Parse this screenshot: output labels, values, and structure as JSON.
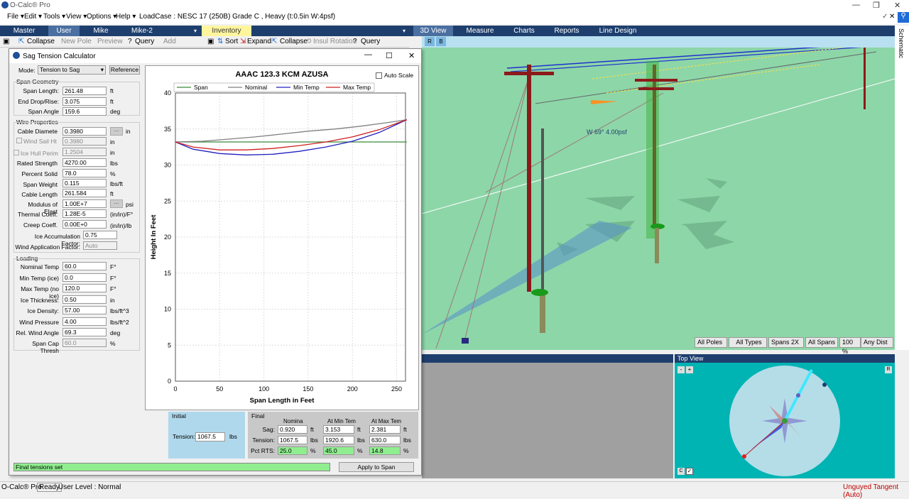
{
  "window": {
    "title": "O-Calc® Pro"
  },
  "menu": {
    "items": [
      "File ▾",
      "Edit ▾",
      "Tools ▾",
      "View ▾",
      "Options ▾",
      "Help ▾"
    ],
    "loadcase": "LoadCase : NESC  17 (250B) Grade C , Heavy (t:0.5in W:4psf)"
  },
  "tabs_left": [
    "Master",
    "User",
    "Mike",
    "Mike-2"
  ],
  "tab_inventory": "Inventory",
  "tabs_right": [
    "3D View",
    "Measure",
    "Charts",
    "Reports",
    "Line Design"
  ],
  "schematic_label": "Schematic",
  "toolbar_left": {
    "collapse": "Collapse",
    "new_pole": "New Pole",
    "preview": "Preview",
    "query": "Query",
    "add": "Add"
  },
  "toolbar_mid": {
    "sort": "Sort",
    "expand": "Expand",
    "collapse": "Collapse",
    "insul_rotation": "Insul Rotation",
    "query": "Query"
  },
  "view3d": {
    "btn_r": "R",
    "btn_b": "B",
    "wind_label": "W 69° 4.00psf",
    "controls": [
      "All Poles",
      "All Types",
      "Spans 2X",
      "All Spans",
      "100 %",
      "Any Dist"
    ]
  },
  "topview": {
    "title": "Top View",
    "btn_minus": "-",
    "btn_plus": "+",
    "btn_r": "R",
    "btn_c": "C"
  },
  "status": {
    "app": "O-Calc® Pro",
    "ready": "Ready",
    "user_level": "User Level : Normal",
    "right": "Unguyed Tangent (Auto)"
  },
  "dialog": {
    "title": "Sag Tension Calculator",
    "mode_label": "Mode:",
    "mode_value": "Tension to Sag",
    "reference_btn": "Reference",
    "span_geometry": {
      "title": "Span Geometry",
      "fields": [
        {
          "label": "Span Length:",
          "value": "261.48",
          "unit": "ft"
        },
        {
          "label": "End Drop/Rise:",
          "value": "3.075",
          "unit": "ft"
        },
        {
          "label": "Span Angle",
          "value": "159.6",
          "unit": "deg"
        }
      ]
    },
    "wire_properties": {
      "title": "Wire Properties",
      "cable_diameter": {
        "label": "Cable Diamete",
        "value": "0.3980",
        "unit": "in"
      },
      "wind_sail": {
        "label": "Wind Sail Ht",
        "value": "0.3980",
        "unit": "in"
      },
      "ice_hull": {
        "label": "Ice Hull Perim",
        "value": "1.2504",
        "unit": "in"
      },
      "fields": [
        {
          "label": "Rated Strength",
          "value": "4270.00",
          "unit": "lbs"
        },
        {
          "label": "Percent Solid",
          "value": "78.0",
          "unit": "%"
        },
        {
          "label": "Span Weight",
          "value": "0.115",
          "unit": "lbs/ft"
        },
        {
          "label": "Cable Length",
          "value": "261.584",
          "unit": "ft"
        },
        {
          "label": "Modulus of Elast",
          "value": "1.00E+7",
          "unit": "psi"
        },
        {
          "label": "Thermal Coeff.",
          "value": "1.28E-5",
          "unit": "(in/in)/F°"
        },
        {
          "label": "Creep Coeff.",
          "value": "0.00E+0",
          "unit": "(in/in)/lb"
        }
      ],
      "ice_accum": {
        "label": "Ice Accumulation Factor:",
        "value": "0.75"
      },
      "wind_app": {
        "label": "Wind Application Factor:",
        "value": "Auto"
      }
    },
    "loading": {
      "title": "Loading",
      "fields": [
        {
          "label": "Nominal Temp",
          "value": "60.0",
          "unit": "F°"
        },
        {
          "label": "Min Temp (ice)",
          "value": "0.0",
          "unit": "F°"
        },
        {
          "label": "Max Temp (no ice)",
          "value": "120.0",
          "unit": "F°"
        },
        {
          "label": "Ice Thickness:",
          "value": "0.50",
          "unit": "in"
        },
        {
          "label": "Ice Density:",
          "value": "57.00",
          "unit": "lbs/ft^3"
        },
        {
          "label": "Wind Pressure",
          "value": "4.00",
          "unit": "lbs/ft^2"
        },
        {
          "label": "Rel. Wind Angle",
          "value": "69.3",
          "unit": "deg"
        },
        {
          "label": "Span Cap Thresh",
          "value": "60.0",
          "unit": "%"
        }
      ]
    },
    "initial": {
      "title": "Initial",
      "tension_label": "Tension:",
      "tension_value": "1067.5",
      "unit": "lbs"
    },
    "final": {
      "title": "Final",
      "headers": [
        "Nomina",
        "At Min Tem",
        "At Max Tem"
      ],
      "rows": [
        {
          "label": "Sag:",
          "values": [
            "0.920",
            "3.153",
            "2.381"
          ],
          "units": [
            "ft",
            "ft",
            "ft"
          ]
        },
        {
          "label": "Tension:",
          "values": [
            "1067.5",
            "1920.6",
            "630.0"
          ],
          "units": [
            "lbs",
            "lbs",
            "lbs"
          ]
        },
        {
          "label": "Pct RTS:",
          "values": [
            "25.0",
            "45.0",
            "14.8"
          ],
          "units": [
            "%",
            "%",
            "%"
          ]
        }
      ]
    },
    "message": "Final tensions set",
    "apply_btn": "Apply to Span",
    "auto_scale": "Auto Scale"
  },
  "chart_data": {
    "type": "line",
    "title": "AAAC 123.3 KCM AZUSA",
    "xlabel": "Span Length in Feet",
    "ylabel": "Height In Feet",
    "xlim": [
      0,
      260
    ],
    "ylim": [
      0,
      40
    ],
    "xticks": [
      0,
      50,
      100,
      150,
      200,
      250
    ],
    "yticks": [
      0,
      5,
      10,
      15,
      20,
      25,
      30,
      35,
      40
    ],
    "legend": "top",
    "grid": true,
    "series": [
      {
        "name": "Span",
        "color": "#3a8a3a",
        "x": [
          0,
          261.48
        ],
        "y": [
          33.2,
          33.2
        ]
      },
      {
        "name": "Nominal",
        "color": "#808080",
        "x": [
          0,
          30,
          60,
          90,
          120,
          150,
          180,
          210,
          240,
          261.48
        ],
        "y": [
          33.2,
          33.3,
          33.6,
          33.9,
          34.3,
          34.7,
          35.0,
          35.4,
          35.9,
          36.3
        ]
      },
      {
        "name": "Min Temp",
        "color": "#2020c0",
        "x": [
          0,
          20,
          50,
          80,
          110,
          140,
          170,
          200,
          230,
          261.48
        ],
        "y": [
          33.2,
          32.2,
          31.6,
          31.4,
          31.5,
          31.9,
          32.5,
          33.3,
          34.5,
          36.3
        ]
      },
      {
        "name": "Max Temp",
        "color": "#d02020",
        "x": [
          0,
          20,
          50,
          80,
          110,
          140,
          170,
          200,
          230,
          261.48
        ],
        "y": [
          33.2,
          32.5,
          32.1,
          32.1,
          32.3,
          32.7,
          33.2,
          33.9,
          34.9,
          36.3
        ]
      }
    ]
  }
}
